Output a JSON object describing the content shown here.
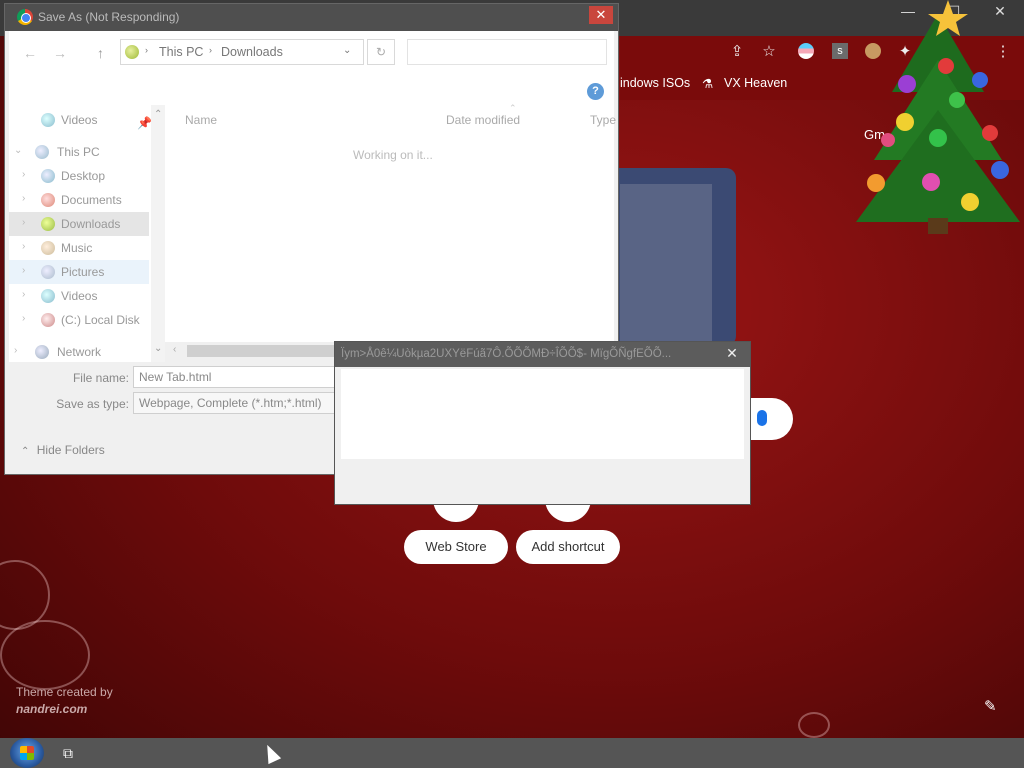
{
  "colors": {
    "theme_red": "#7a0b0b",
    "dialog_bg": "#f0f0f0",
    "titlebar_inactive": "#4f4f4f",
    "close_red": "#c9463d",
    "mic_blue": "#1a73e8"
  },
  "chrome": {
    "bookmarks": [
      "indows ISOs",
      "VX Heaven"
    ],
    "gmail_link": "Gm",
    "shortcuts": {
      "web_store": "Web Store",
      "add_shortcut": "Add shortcut"
    },
    "theme_credit": {
      "line1": "Theme created by",
      "line2": "nandrei.com"
    },
    "toolbar_icons": [
      "share-icon",
      "star-icon",
      "profile-flag-icon",
      "extension-s-icon",
      "avatar-icon",
      "puzzle-icon",
      "more-vert-icon"
    ]
  },
  "save_dialog": {
    "title": "Save As (Not Responding)",
    "close_glyph": "✕",
    "breadcrumb": [
      "This PC",
      "Downloads"
    ],
    "help_glyph": "?",
    "nav_items": [
      {
        "label": "Videos",
        "icon": "videos-icon"
      },
      {
        "label": "This PC",
        "icon": "this-pc-icon"
      },
      {
        "label": "Desktop",
        "icon": "desktop-icon"
      },
      {
        "label": "Documents",
        "icon": "documents-icon"
      },
      {
        "label": "Downloads",
        "icon": "downloads-icon"
      },
      {
        "label": "Music",
        "icon": "music-icon"
      },
      {
        "label": "Pictures",
        "icon": "pictures-icon"
      },
      {
        "label": "Videos",
        "icon": "videos-icon"
      },
      {
        "label": "(C:) Local Disk",
        "icon": "disk-icon"
      },
      {
        "label": "Network",
        "icon": "network-icon"
      }
    ],
    "columns": {
      "name": "Name",
      "date": "Date modified",
      "type": "Type"
    },
    "status_text": "Working on it...",
    "file_name_label": "File name:",
    "file_name_value": "New Tab.html",
    "save_type_label": "Save as type:",
    "save_type_value": "Webpage, Complete (*.htm;*.html)",
    "hide_folders": "Hide Folders"
  },
  "popup": {
    "title": "Ïym>Å0ê¼Uòkµa2UXYëFúã7Ô.ÕÕÕMÐ÷ÎÕÕ$- MïgÕÑgfEÕÕ...",
    "close_glyph": "✕"
  },
  "taskbar": {
    "task_view_glyph": "⧉"
  }
}
